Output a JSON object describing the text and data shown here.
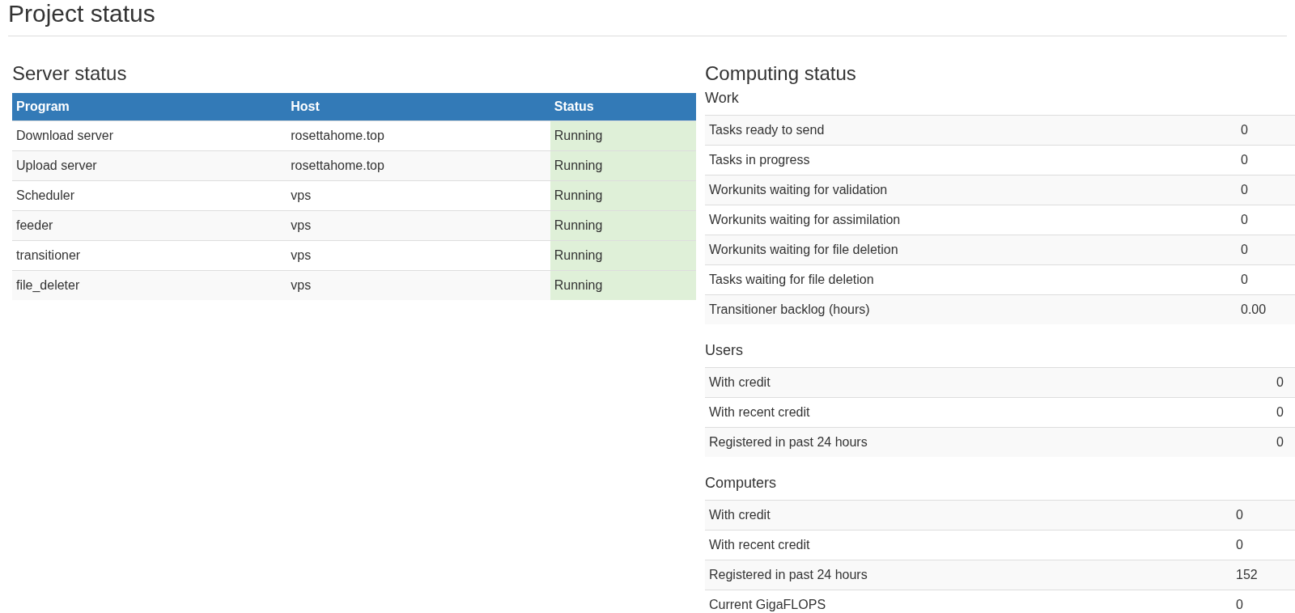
{
  "page_title": "Project status",
  "server_status": {
    "title": "Server status",
    "columns": [
      "Program",
      "Host",
      "Status"
    ],
    "rows": [
      {
        "program": "Download server",
        "host": "rosettahome.top",
        "status": "Running",
        "running": true
      },
      {
        "program": "Upload server",
        "host": "rosettahome.top",
        "status": "Running",
        "running": true
      },
      {
        "program": "Scheduler",
        "host": "vps",
        "status": "Running",
        "running": true
      },
      {
        "program": "feeder",
        "host": "vps",
        "status": "Running",
        "running": true
      },
      {
        "program": "transitioner",
        "host": "vps",
        "status": "Running",
        "running": true
      },
      {
        "program": "file_deleter",
        "host": "vps",
        "status": "Running",
        "running": true
      }
    ]
  },
  "computing_status": {
    "title": "Computing status",
    "sections": [
      {
        "title": "Work",
        "rows": [
          {
            "label": "Tasks ready to send",
            "value": "0"
          },
          {
            "label": "Tasks in progress",
            "value": "0"
          },
          {
            "label": "Workunits waiting for validation",
            "value": "0"
          },
          {
            "label": "Workunits waiting for assimilation",
            "value": "0"
          },
          {
            "label": "Workunits waiting for file deletion",
            "value": "0"
          },
          {
            "label": "Tasks waiting for file deletion",
            "value": "0"
          },
          {
            "label": "Transitioner backlog (hours)",
            "value": "0.00"
          }
        ]
      },
      {
        "title": "Users",
        "rows": [
          {
            "label": "With credit",
            "value": "0"
          },
          {
            "label": "With recent credit",
            "value": "0"
          },
          {
            "label": "Registered in past 24 hours",
            "value": "0"
          }
        ]
      },
      {
        "title": "Computers",
        "rows": [
          {
            "label": "With credit",
            "value": "0"
          },
          {
            "label": "With recent credit",
            "value": "0"
          },
          {
            "label": "Registered in past 24 hours",
            "value": "152"
          },
          {
            "label": "Current GigaFLOPS",
            "value": "0"
          }
        ]
      }
    ]
  }
}
